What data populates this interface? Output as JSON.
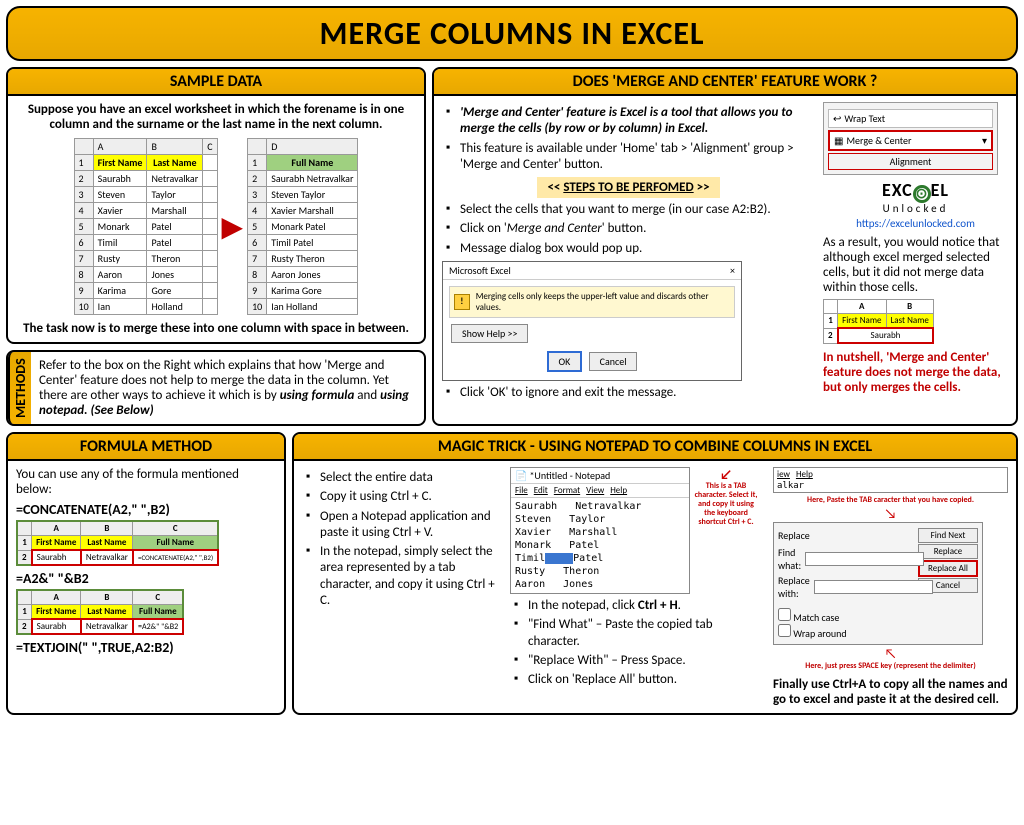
{
  "title": "MERGE COLUMNS IN EXCEL",
  "sample": {
    "header": "SAMPLE DATA",
    "p1": "Suppose you have an excel worksheet in which the forename is in one column and the surname or the last name in the next column.",
    "p2": "The task now is to merge these into one column with space in between.",
    "cols": {
      "a": "First Name",
      "b": "Last Name",
      "d": "Full Name"
    },
    "rows": [
      {
        "n": "2",
        "f": "Saurabh",
        "l": "Netravalkar",
        "full": "Saurabh Netravalkar"
      },
      {
        "n": "3",
        "f": "Steven",
        "l": "Taylor",
        "full": "Steven Taylor"
      },
      {
        "n": "4",
        "f": "Xavier",
        "l": "Marshall",
        "full": "Xavier Marshall"
      },
      {
        "n": "5",
        "f": "Monark",
        "l": "Patel",
        "full": "Monark Patel"
      },
      {
        "n": "6",
        "f": "Timil",
        "l": "Patel",
        "full": "Timil Patel"
      },
      {
        "n": "7",
        "f": "Rusty",
        "l": "Theron",
        "full": "Rusty Theron"
      },
      {
        "n": "8",
        "f": "Aaron",
        "l": "Jones",
        "full": "Aaron Jones"
      },
      {
        "n": "9",
        "f": "Karima",
        "l": "Gore",
        "full": "Karima Gore"
      },
      {
        "n": "10",
        "f": "Ian",
        "l": "Holland",
        "full": "Ian Holland"
      }
    ]
  },
  "methods": {
    "label": "METHODS",
    "text_a": "Refer to the box on the Right which explains that how 'Merge and Center' feature does not help to merge the data in the column. Yet there are other ways to achieve it which is by ",
    "text_b": "using formula",
    "text_c": " and ",
    "text_d": "using notepad. (See Below)"
  },
  "mc": {
    "header": "DOES 'MERGE AND CENTER' FEATURE WORK ?",
    "b1": "'Merge and Center' feature is Excel is a tool that allows you to merge the cells (by row or by column) in Excel.",
    "b2": "This feature is available under 'Home' tab > 'Alignment' group > 'Merge and Center' button.",
    "stepsH": "<< STEPS TO BE PERFOMED >>",
    "s1": "Select the cells that you want to merge (in our case A2:B2).",
    "s2a": "Click on '",
    "s2b": "Merge and Center",
    "s2c": "' button.",
    "s3": "Message dialog box would pop up.",
    "s4": "Click 'OK' to ignore and exit the message.",
    "dlgTitle": "Microsoft Excel",
    "dlgMsg": "Merging cells only keeps the upper-left value and discards other values.",
    "showHelp": "Show Help >>",
    "ok": "OK",
    "cancel": "Cancel",
    "ribWrap": "Wrap Text",
    "ribMerge": "Merge & Center",
    "ribAlign": "Alignment",
    "brand1": "EXC",
    "brand2": "EL",
    "brand3": "Unlocked",
    "url": "https://excelunlocked.com",
    "resultP": "As a result, you would notice that although excel merged selected cells, but it did not merge data within those cells.",
    "miniH1": "First Name",
    "miniH2": "Last Name",
    "miniV": "Saurabh",
    "concl": "In nutshell, 'Merge and Center' feature does not merge the data, but only merges the cells."
  },
  "fm": {
    "header": "FORMULA METHOD",
    "intro": "You can use any of the formula mentioned below:",
    "f1": "=CONCATENATE(A2,\" \",B2)",
    "f2": "=A2&\" \"&B2",
    "f3": "=TEXTJOIN(\" \",TRUE,A2:B2)",
    "th1": "First Name",
    "th2": "Last Name",
    "th3": "Full Name",
    "r1": "Saurabh",
    "r2": "Netravalkar",
    "cell1": "=CONCATENATE(A2,\" \",B2)",
    "cell2": "=A2&\" \"&B2"
  },
  "np": {
    "header": "MAGIC TRICK - USING NOTEPAD TO COMBINE COLUMNS IN EXCEL",
    "s1": "Select the entire data",
    "s2": "Copy it using Ctrl + C.",
    "s3": "Open a Notepad application and paste it using Ctrl + V.",
    "s4": "In the notepad, simply select the area represented by a tab character, and copy it using Ctrl + C.",
    "s5a": "In the notepad, click ",
    "s5b": "Ctrl + H",
    "s5c": ".",
    "s6": "\"Find What\" – Paste the copied tab character.",
    "s7": "\"Replace With\" – Press Space.",
    "s8": "Click on 'Replace All' button.",
    "npTitle": "*Untitled - Notepad",
    "menu": {
      "f": "File",
      "e": "Edit",
      "fo": "Format",
      "v": "View",
      "h": "Help"
    },
    "names": [
      [
        "Saurabh",
        "Netravalkar"
      ],
      [
        "Steven",
        "Taylor"
      ],
      [
        "Xavier",
        "Marshall"
      ],
      [
        "Monark",
        "Patel"
      ],
      [
        "Timil",
        "Patel"
      ],
      [
        "Rusty",
        "Theron"
      ],
      [
        "Aaron",
        "Jones"
      ]
    ],
    "annot1": "This is a TAB character. Select it, and copy it using the keyboard shortcut Ctrl + C.",
    "repTitle": "Replace",
    "findWhat": "Find what:",
    "repWith": "Replace with:",
    "findNext": "Find Next",
    "replace": "Replace",
    "replaceAll": "Replace All",
    "cancel": "Cancel",
    "matchCase": "Match case",
    "wrap": "Wrap around",
    "a2a": "Here, Paste the TAB caracter that you have copied.",
    "a2b": "Here, just press SPACE key (represent the delimiter)",
    "final": "Finally use Ctrl+A to copy all the names and go to excel and paste it at the desired cell.",
    "corner": "alkar",
    "cornerMenu1": "iew",
    "cornerMenu2": "Help"
  }
}
